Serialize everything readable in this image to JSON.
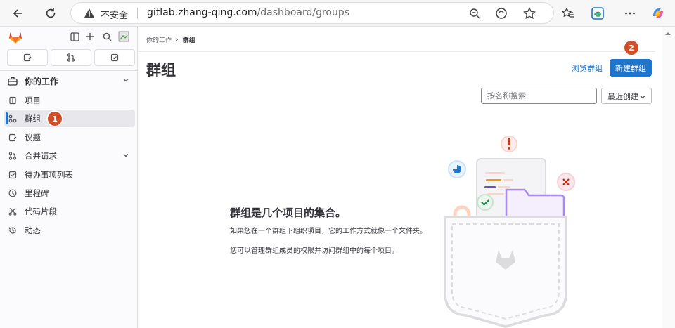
{
  "browser": {
    "insecure_label": "不安全",
    "url_host": "gitlab.zhang-qing.com",
    "url_path": "/dashboard/groups"
  },
  "sidebar": {
    "section_label": "你的工作",
    "items": [
      {
        "label": "项目",
        "icon": "project-icon"
      },
      {
        "label": "群组",
        "icon": "group-icon",
        "active": true
      },
      {
        "label": "议题",
        "icon": "issues-icon"
      },
      {
        "label": "合并请求",
        "icon": "merge-request-icon",
        "has_chevron": true
      },
      {
        "label": "待办事项列表",
        "icon": "todo-icon"
      },
      {
        "label": "里程碑",
        "icon": "milestone-icon"
      },
      {
        "label": "代码片段",
        "icon": "snippet-icon"
      },
      {
        "label": "动态",
        "icon": "activity-icon"
      }
    ]
  },
  "annotations": {
    "step1": "1",
    "step2": "2"
  },
  "main": {
    "breadcrumb": [
      "你的工作",
      "群组"
    ],
    "title": "群组",
    "explore_link": "浏览群组",
    "new_group_button": "新建群组",
    "search_placeholder": "按名称搜索",
    "sort_label": "最近创建",
    "empty_title": "群组是几个项目的集合。",
    "empty_desc1": "如果您在一个群组下组织项目，它的工作方式就像一个文件夹。",
    "empty_desc2": "您可以管理群组成员的权限并访问群组中的每个项目。"
  },
  "colors": {
    "accent": "#1f75cb",
    "badge": "#d04f2a",
    "brand": "#e24329"
  }
}
